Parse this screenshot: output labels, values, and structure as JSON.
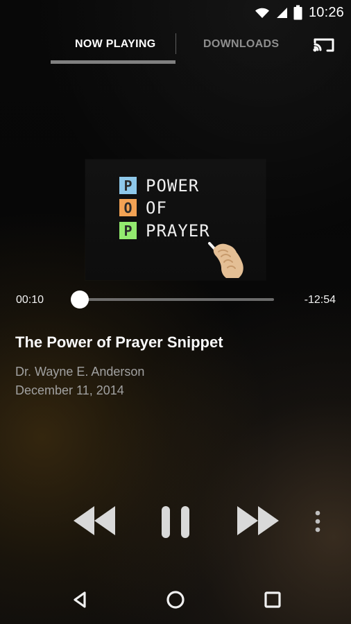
{
  "status_bar": {
    "time": "10:26",
    "icons": [
      "wifi-icon",
      "signal-icon",
      "battery-icon"
    ]
  },
  "tabs": [
    {
      "label": "NOW PLAYING",
      "selected": true
    },
    {
      "label": "DOWNLOADS",
      "selected": false
    }
  ],
  "toolbar": {
    "cast_icon": "cast-icon"
  },
  "cover": {
    "lines": [
      {
        "letter": "P",
        "word": "POWER",
        "box_color": "#8ec8ea"
      },
      {
        "letter": "O",
        "word": "OF",
        "box_color": "#f2a254"
      },
      {
        "letter": "P",
        "word": "PRAYER",
        "box_color": "#93ea6f"
      }
    ]
  },
  "player": {
    "elapsed": "00:10",
    "remaining": "-12:54",
    "progress_fraction": 0.0,
    "title": "The Power of Prayer Snippet",
    "speaker": "Dr. Wayne E. Anderson",
    "date": "December 11, 2014"
  },
  "controls": {
    "rewind_icon": "rewind-icon",
    "pause_icon": "pause-icon",
    "forward_icon": "fast-forward-icon",
    "more_icon": "more-vertical-icon"
  },
  "navigation": {
    "back_icon": "back-icon",
    "home_icon": "home-icon",
    "recent_icon": "recent-apps-icon"
  }
}
